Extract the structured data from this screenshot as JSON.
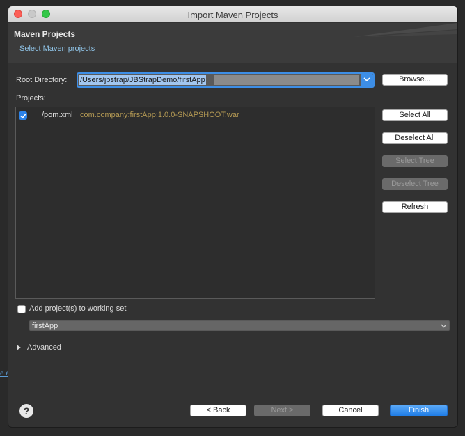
{
  "window": {
    "title": "Import Maven Projects"
  },
  "header": {
    "title": "Maven Projects",
    "subtitle": "Select Maven projects"
  },
  "root_directory": {
    "label": "Root Directory:",
    "value": "/Users/jbstrap/JBStrapDemo/firstApp",
    "browse_label": "Browse..."
  },
  "projects": {
    "label": "Projects:",
    "items": [
      {
        "checked": true,
        "path": "/pom.xml",
        "coordinates": "com.company:firstApp:1.0.0-SNAPSHOOT:war"
      }
    ]
  },
  "side_buttons": {
    "select_all": "Select All",
    "deselect_all": "Deselect All",
    "select_tree": "Select Tree",
    "deselect_tree": "Deselect Tree",
    "refresh": "Refresh"
  },
  "working_set": {
    "checkbox_label": "Add project(s) to working set",
    "checked": false,
    "value": "firstApp"
  },
  "advanced": {
    "label": "Advanced"
  },
  "footer": {
    "back": "< Back",
    "next": "Next >",
    "cancel": "Cancel",
    "finish": "Finish",
    "help": "?"
  },
  "colors": {
    "accent": "#3d8ee6",
    "coordinates": "#b59a54",
    "subtitle": "#8fc3e6"
  },
  "background": {
    "link_fragment": "e a"
  }
}
